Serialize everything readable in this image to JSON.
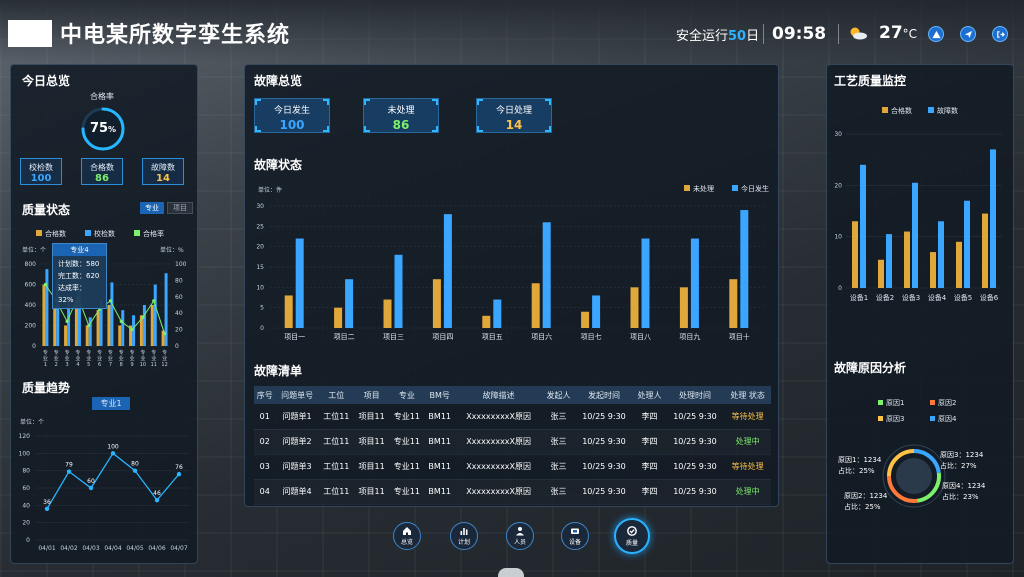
{
  "header": {
    "title": "中电某所数字孪生系统",
    "safe_prefix": "安全运行",
    "safe_days": "50",
    "safe_suffix": "日",
    "time": "09:58",
    "temp": "27",
    "temp_unit": "°C"
  },
  "today": {
    "title": "今日总览",
    "pass_rate_label": "合格率",
    "pass_rate": "75",
    "pass_rate_unit": "%",
    "cards": [
      {
        "label": "校检数",
        "value": "100",
        "color": "#3aa6ff"
      },
      {
        "label": "合格数",
        "value": "86",
        "color": "#7cf06a"
      },
      {
        "label": "故障数",
        "value": "14",
        "color": "#ffc247"
      }
    ]
  },
  "quality_status": {
    "title": "质量状态",
    "toggle": [
      "专业",
      "项目"
    ],
    "tooltip": {
      "title": "专业4",
      "rows": [
        "计划数：580",
        "完工数：620",
        "达成率：32%"
      ]
    },
    "chart_data": {
      "type": "bar",
      "title": "",
      "ylabel_left": "单位：个",
      "ylabel_right": "单位：%",
      "legend": [
        "合格数",
        "校检数",
        "合格率"
      ],
      "legend_colors": [
        "#e0a83a",
        "#3aa6ff",
        "#7cf06a"
      ],
      "ylim_left": [
        0,
        800
      ],
      "y_ticks_left": [
        "800",
        "600",
        "400",
        "200",
        "0"
      ],
      "ylim_right": [
        0,
        100
      ],
      "y_ticks_right": [
        "100",
        "80",
        "60",
        "40",
        "20",
        "0"
      ],
      "categories": [
        "专业1",
        "专业2",
        "专业3",
        "专业4",
        "专业5",
        "专业6",
        "专业7",
        "专业8",
        "专业9",
        "专业10",
        "专业11",
        "专业12"
      ],
      "series": [
        {
          "name": "合格数",
          "values": [
            600,
            400,
            200,
            450,
            200,
            350,
            400,
            200,
            200,
            300,
            400,
            150
          ]
        },
        {
          "name": "校检数",
          "values": [
            750,
            650,
            420,
            550,
            280,
            450,
            620,
            350,
            300,
            400,
            600,
            710
          ]
        },
        {
          "name": "合格率",
          "values": [
            75,
            55,
            30,
            60,
            25,
            45,
            55,
            30,
            20,
            35,
            55,
            15
          ]
        }
      ]
    }
  },
  "quality_trend": {
    "title": "质量趋势",
    "selector": "专业1",
    "chart_data": {
      "type": "line",
      "ylabel": "单位：个",
      "ylim": [
        0,
        120
      ],
      "y_ticks": [
        "120",
        "100",
        "80",
        "60",
        "40",
        "20",
        "0"
      ],
      "categories": [
        "04/01",
        "04/02",
        "04/03",
        "04/04",
        "04/05",
        "04/06",
        "04/07"
      ],
      "values": [
        36,
        79,
        60,
        100,
        80,
        46,
        76
      ],
      "labels": [
        "36",
        "79",
        "60",
        "100",
        "80",
        "46",
        "76"
      ]
    }
  },
  "fault_overview": {
    "title": "故障总览",
    "cards": [
      {
        "label": "今日发生",
        "value": "100",
        "color": "#3aa6ff"
      },
      {
        "label": "未处理",
        "value": "86",
        "color": "#7cf06a"
      },
      {
        "label": "今日处理",
        "value": "14",
        "color": "#ffc247"
      }
    ]
  },
  "fault_status": {
    "title": "故障状态",
    "chart_data": {
      "type": "bar",
      "ylabel": "单位：件",
      "ylim": [
        0,
        30
      ],
      "y_ticks": [
        "30",
        "25",
        "20",
        "15",
        "10",
        "5",
        "0"
      ],
      "legend": [
        "未处理",
        "今日发生"
      ],
      "legend_colors": [
        "#e0a83a",
        "#3aa6ff"
      ],
      "categories": [
        "项目一",
        "项目二",
        "项目三",
        "项目四",
        "项目五",
        "项目六",
        "项目七",
        "项目八",
        "项目九",
        "项目十"
      ],
      "series": [
        {
          "name": "未处理",
          "values": [
            8,
            5,
            7,
            12,
            3,
            11,
            4,
            10,
            10,
            12
          ]
        },
        {
          "name": "今日发生",
          "values": [
            22,
            12,
            18,
            28,
            7,
            26,
            8,
            22,
            22,
            29
          ]
        }
      ]
    }
  },
  "fault_list": {
    "title": "故障清单",
    "columns": [
      "序号",
      "问题单号",
      "工位",
      "项目",
      "专业",
      "BM号",
      "故障描述",
      "发起人",
      "发起时间",
      "处理人",
      "处理时间",
      "处理 状态"
    ],
    "rows": [
      [
        "01",
        "问题单1",
        "工位11",
        "项目11",
        "专业11",
        "BM11",
        "XxxxxxxxxX原因",
        "张三",
        "10/25 9:30",
        "李四",
        "10/25 9:30",
        "等待处理"
      ],
      [
        "02",
        "问题单2",
        "工位11",
        "项目11",
        "专业11",
        "BM11",
        "XxxxxxxxxX原因",
        "张三",
        "10/25 9:30",
        "李四",
        "10/25 9:30",
        "处理中"
      ],
      [
        "03",
        "问题单3",
        "工位11",
        "项目11",
        "专业11",
        "BM11",
        "XxxxxxxxxX原因",
        "张三",
        "10/25 9:30",
        "李四",
        "10/25 9:30",
        "等待处理"
      ],
      [
        "04",
        "问题单4",
        "工位11",
        "项目11",
        "专业11",
        "BM11",
        "XxxxxxxxxX原因",
        "张三",
        "10/25 9:30",
        "李四",
        "10/25 9:30",
        "处理中"
      ]
    ],
    "status_colors": {
      "等待处理": "#ffc247",
      "处理中": "#7cf06a"
    }
  },
  "nav": [
    {
      "label": "总览",
      "icon": "home-icon"
    },
    {
      "label": "计划",
      "icon": "chart-icon"
    },
    {
      "label": "人员",
      "icon": "person-icon"
    },
    {
      "label": "设备",
      "icon": "device-icon"
    },
    {
      "label": "质量",
      "icon": "quality-icon"
    }
  ],
  "process_quality": {
    "title": "工艺质量监控",
    "chart_data": {
      "type": "bar",
      "ylim": [
        0,
        30
      ],
      "y_ticks": [
        "30",
        "20",
        "10",
        "0"
      ],
      "legend": [
        "合格数",
        "故障数"
      ],
      "legend_colors": [
        "#e0a83a",
        "#3aa6ff"
      ],
      "categories": [
        "设备1",
        "设备2",
        "设备3",
        "设备4",
        "设备5",
        "设备6"
      ],
      "series": [
        {
          "name": "合格数",
          "values": [
            13,
            5.5,
            11,
            7,
            9,
            14.5
          ]
        },
        {
          "name": "故障数",
          "values": [
            24,
            10.5,
            20.5,
            13,
            17,
            27
          ]
        }
      ]
    }
  },
  "fault_causes": {
    "title": "故障原因分析",
    "chart_data": {
      "type": "pie",
      "legend": [
        "原因1",
        "原因2",
        "原因3",
        "原因4"
      ],
      "legend_colors": [
        "#7cf06a",
        "#ff7a3a",
        "#ffc247",
        "#3aa6ff"
      ],
      "values": [
        25,
        27,
        25,
        23
      ],
      "labels": [
        {
          "name": "原因1：1234",
          "pct": "占比：25%"
        },
        {
          "name": "原因3：1234",
          "pct": "占比：27%"
        },
        {
          "name": "原因2：1234",
          "pct": "占比：25%"
        },
        {
          "name": "原因4：1234",
          "pct": "占比：23%"
        }
      ]
    }
  }
}
